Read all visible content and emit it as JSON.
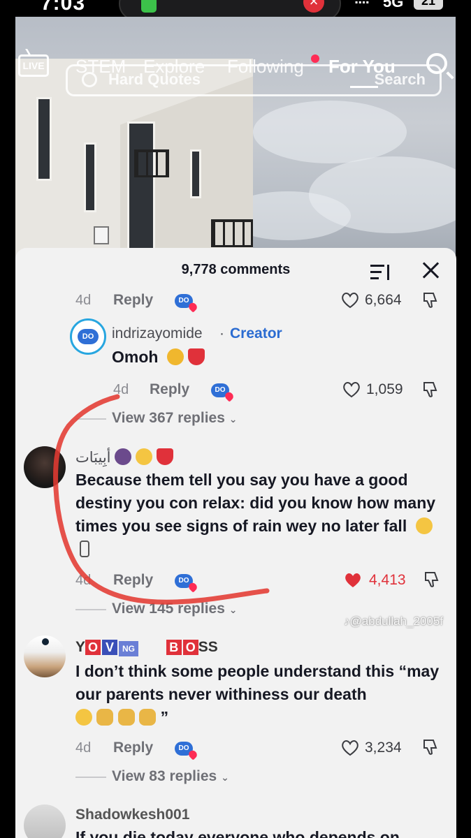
{
  "status_bar": {
    "time": "7:03",
    "network": "5G",
    "battery": "21"
  },
  "top_nav": {
    "tabs": [
      {
        "label": "STEM"
      },
      {
        "label": "Explore"
      },
      {
        "label": "Following"
      },
      {
        "label": "For You"
      }
    ],
    "live_label": "LIVE"
  },
  "search_bar": {
    "query": "Hard Quotes",
    "action": "Search"
  },
  "comments_panel": {
    "count_label": "9,778 comments",
    "comments": [
      {
        "age": "4d",
        "reply_label": "Reply",
        "likes": "6,664"
      },
      {
        "username": "indrizayomide",
        "separator": "·",
        "creator_tag": "Creator",
        "text": "Omoh",
        "age": "4d",
        "reply_label": "Reply",
        "likes": "1,059",
        "view_replies": "View 367 replies"
      },
      {
        "username": "أبِيبَات",
        "text": "Because them tell you say you have a good destiny you con relax: did you know how many times you see signs of rain wey no later fall",
        "age": "4d",
        "reply_label": "Reply",
        "likes": "4,413",
        "liked": true,
        "view_replies": "View 145 replies"
      },
      {
        "username_parts": [
          "Y",
          "O",
          "V",
          "NG",
          "B",
          "O",
          "SS"
        ],
        "text": "I don’t think some people understand this “may our parents never withiness our death",
        "text_tail": "”",
        "age": "4d",
        "reply_label": "Reply",
        "likes": "3,234",
        "view_replies": "View 83 replies"
      },
      {
        "username": "Shadowkesh001",
        "text": "If you die today everyone who depends on"
      }
    ]
  },
  "watermark": "@abdullah_2005f",
  "colors": {
    "accent_red": "#fe2c55",
    "like_red": "#e0313a",
    "creator_blue": "#2b6cd1",
    "annotation_red": "#e23a32"
  },
  "icons": [
    "live-icon",
    "search-icon",
    "sort-icon",
    "close-icon",
    "heart-icon",
    "dislike-icon",
    "badge-icon",
    "chevron-down-icon"
  ]
}
